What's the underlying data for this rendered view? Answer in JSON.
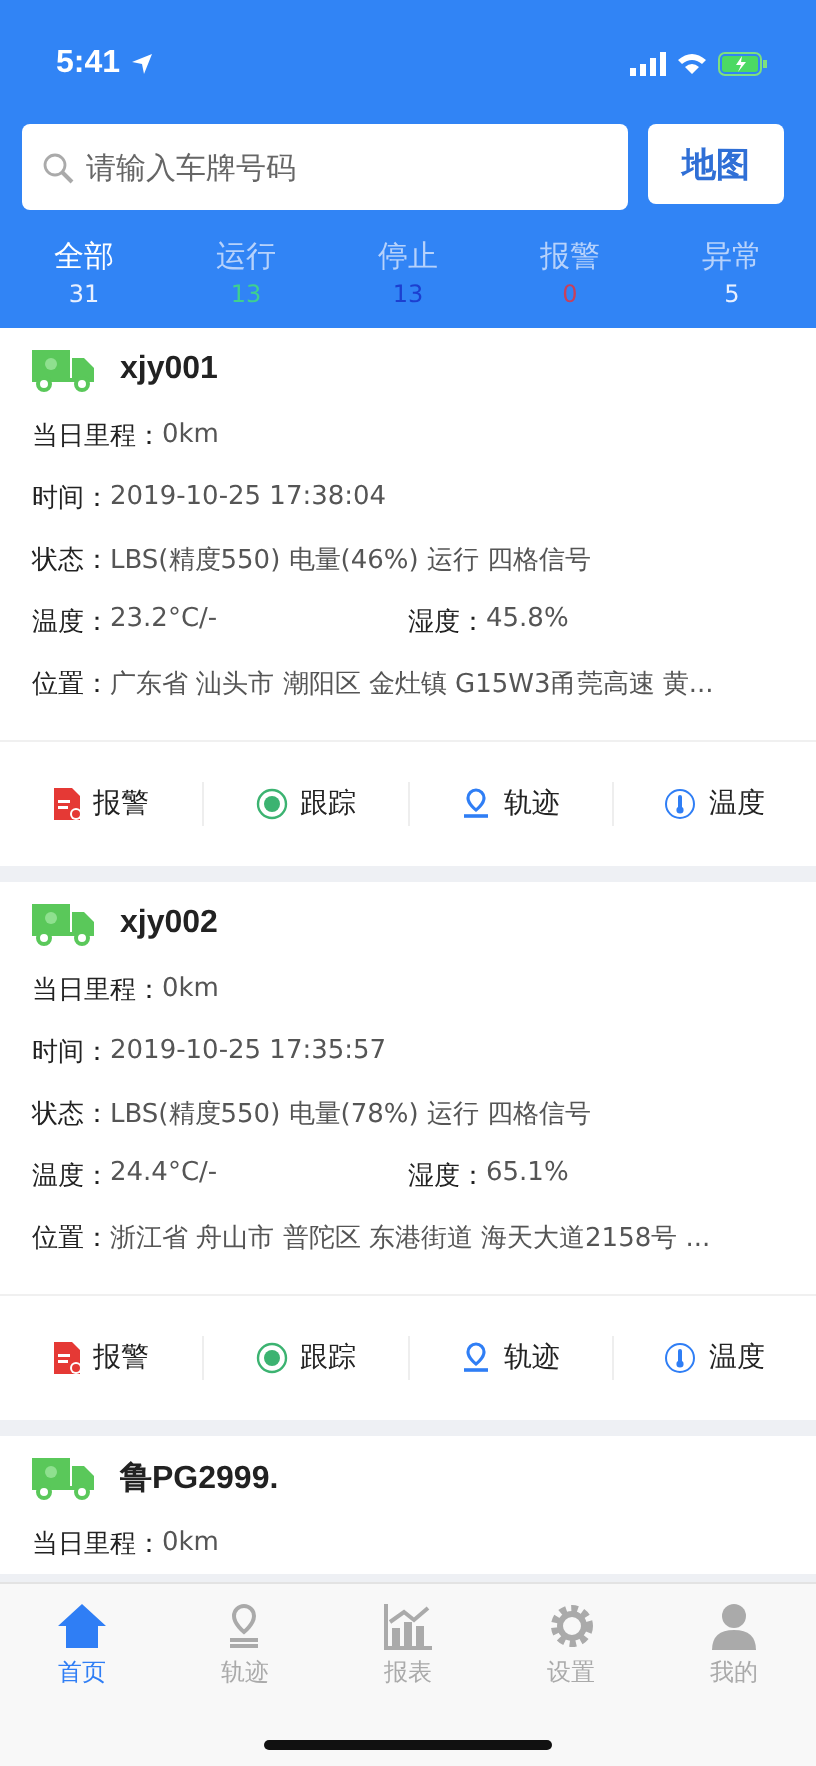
{
  "status_bar": {
    "time": "5:41"
  },
  "search": {
    "placeholder": "请输入车牌号码",
    "map_button": "地图"
  },
  "tabs": [
    {
      "label": "全部",
      "count": "31",
      "color": "#e8f0ff",
      "selected": true
    },
    {
      "label": "运行",
      "count": "13",
      "color": "#3fd08f",
      "selected": false
    },
    {
      "label": "停止",
      "count": "13",
      "color": "#1c3fd0",
      "selected": false
    },
    {
      "label": "报警",
      "count": "0",
      "color": "#c8405a",
      "selected": false
    },
    {
      "label": "异常",
      "count": "5",
      "color": "#e8f0ff",
      "selected": false
    }
  ],
  "vehicles": [
    {
      "plate": "xjy001",
      "rows": [
        {
          "label": "当日里程：",
          "value": "0km"
        },
        {
          "label": "时间：",
          "value": "2019-10-25 17:38:04"
        },
        {
          "label": "状态：",
          "value": "LBS(精度550) 电量(46%) 运行 四格信号"
        },
        {
          "kind": "pair",
          "label": "温度：",
          "value": "23.2°C/-",
          "label2": "湿度：",
          "value2": "45.8%"
        },
        {
          "label": "位置：",
          "value": "广东省 汕头市 潮阳区 金灶镇 G15W3甬莞高速 黄..."
        }
      ],
      "actions": [
        "报警",
        "跟踪",
        "轨迹",
        "温度"
      ]
    },
    {
      "plate": "xjy002",
      "rows": [
        {
          "label": "当日里程：",
          "value": "0km"
        },
        {
          "label": "时间：",
          "value": "2019-10-25 17:35:57"
        },
        {
          "label": "状态：",
          "value": "LBS(精度550) 电量(78%) 运行 四格信号"
        },
        {
          "kind": "pair",
          "label": "温度：",
          "value": "24.4°C/-",
          "label2": "湿度：",
          "value2": "65.1%"
        },
        {
          "label": "位置：",
          "value": "浙江省 舟山市 普陀区 东港街道 海天大道2158号 ..."
        }
      ],
      "actions": [
        "报警",
        "跟踪",
        "轨迹",
        "温度"
      ]
    },
    {
      "plate": "鲁PG2999.",
      "rows": [
        {
          "label": "当日里程：",
          "value": "0km"
        }
      ]
    }
  ],
  "nav": [
    {
      "label": "首页",
      "selected": true
    },
    {
      "label": "轨迹",
      "selected": false
    },
    {
      "label": "报表",
      "selected": false
    },
    {
      "label": "设置",
      "selected": false
    },
    {
      "label": "我的",
      "selected": false
    }
  ]
}
